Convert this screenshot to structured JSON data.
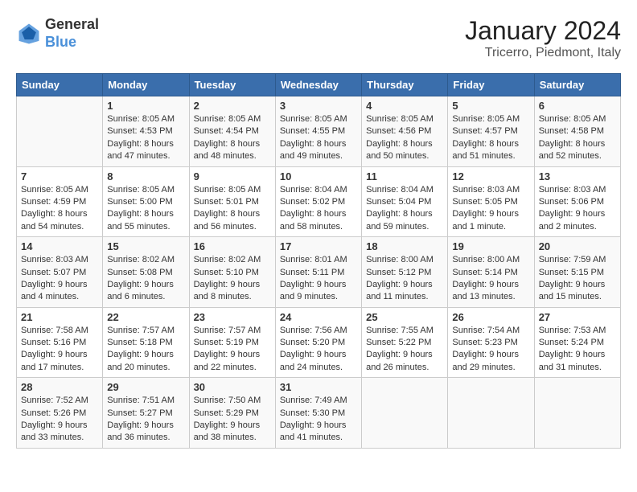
{
  "logo": {
    "text_general": "General",
    "text_blue": "Blue"
  },
  "title": "January 2024",
  "subtitle": "Tricerro, Piedmont, Italy",
  "days_of_week": [
    "Sunday",
    "Monday",
    "Tuesday",
    "Wednesday",
    "Thursday",
    "Friday",
    "Saturday"
  ],
  "weeks": [
    [
      {
        "day": "",
        "info": ""
      },
      {
        "day": "1",
        "info": "Sunrise: 8:05 AM\nSunset: 4:53 PM\nDaylight: 8 hours\nand 47 minutes."
      },
      {
        "day": "2",
        "info": "Sunrise: 8:05 AM\nSunset: 4:54 PM\nDaylight: 8 hours\nand 48 minutes."
      },
      {
        "day": "3",
        "info": "Sunrise: 8:05 AM\nSunset: 4:55 PM\nDaylight: 8 hours\nand 49 minutes."
      },
      {
        "day": "4",
        "info": "Sunrise: 8:05 AM\nSunset: 4:56 PM\nDaylight: 8 hours\nand 50 minutes."
      },
      {
        "day": "5",
        "info": "Sunrise: 8:05 AM\nSunset: 4:57 PM\nDaylight: 8 hours\nand 51 minutes."
      },
      {
        "day": "6",
        "info": "Sunrise: 8:05 AM\nSunset: 4:58 PM\nDaylight: 8 hours\nand 52 minutes."
      }
    ],
    [
      {
        "day": "7",
        "info": "Sunrise: 8:05 AM\nSunset: 4:59 PM\nDaylight: 8 hours\nand 54 minutes."
      },
      {
        "day": "8",
        "info": "Sunrise: 8:05 AM\nSunset: 5:00 PM\nDaylight: 8 hours\nand 55 minutes."
      },
      {
        "day": "9",
        "info": "Sunrise: 8:05 AM\nSunset: 5:01 PM\nDaylight: 8 hours\nand 56 minutes."
      },
      {
        "day": "10",
        "info": "Sunrise: 8:04 AM\nSunset: 5:02 PM\nDaylight: 8 hours\nand 58 minutes."
      },
      {
        "day": "11",
        "info": "Sunrise: 8:04 AM\nSunset: 5:04 PM\nDaylight: 8 hours\nand 59 minutes."
      },
      {
        "day": "12",
        "info": "Sunrise: 8:03 AM\nSunset: 5:05 PM\nDaylight: 9 hours\nand 1 minute."
      },
      {
        "day": "13",
        "info": "Sunrise: 8:03 AM\nSunset: 5:06 PM\nDaylight: 9 hours\nand 2 minutes."
      }
    ],
    [
      {
        "day": "14",
        "info": "Sunrise: 8:03 AM\nSunset: 5:07 PM\nDaylight: 9 hours\nand 4 minutes."
      },
      {
        "day": "15",
        "info": "Sunrise: 8:02 AM\nSunset: 5:08 PM\nDaylight: 9 hours\nand 6 minutes."
      },
      {
        "day": "16",
        "info": "Sunrise: 8:02 AM\nSunset: 5:10 PM\nDaylight: 9 hours\nand 8 minutes."
      },
      {
        "day": "17",
        "info": "Sunrise: 8:01 AM\nSunset: 5:11 PM\nDaylight: 9 hours\nand 9 minutes."
      },
      {
        "day": "18",
        "info": "Sunrise: 8:00 AM\nSunset: 5:12 PM\nDaylight: 9 hours\nand 11 minutes."
      },
      {
        "day": "19",
        "info": "Sunrise: 8:00 AM\nSunset: 5:14 PM\nDaylight: 9 hours\nand 13 minutes."
      },
      {
        "day": "20",
        "info": "Sunrise: 7:59 AM\nSunset: 5:15 PM\nDaylight: 9 hours\nand 15 minutes."
      }
    ],
    [
      {
        "day": "21",
        "info": "Sunrise: 7:58 AM\nSunset: 5:16 PM\nDaylight: 9 hours\nand 17 minutes."
      },
      {
        "day": "22",
        "info": "Sunrise: 7:57 AM\nSunset: 5:18 PM\nDaylight: 9 hours\nand 20 minutes."
      },
      {
        "day": "23",
        "info": "Sunrise: 7:57 AM\nSunset: 5:19 PM\nDaylight: 9 hours\nand 22 minutes."
      },
      {
        "day": "24",
        "info": "Sunrise: 7:56 AM\nSunset: 5:20 PM\nDaylight: 9 hours\nand 24 minutes."
      },
      {
        "day": "25",
        "info": "Sunrise: 7:55 AM\nSunset: 5:22 PM\nDaylight: 9 hours\nand 26 minutes."
      },
      {
        "day": "26",
        "info": "Sunrise: 7:54 AM\nSunset: 5:23 PM\nDaylight: 9 hours\nand 29 minutes."
      },
      {
        "day": "27",
        "info": "Sunrise: 7:53 AM\nSunset: 5:24 PM\nDaylight: 9 hours\nand 31 minutes."
      }
    ],
    [
      {
        "day": "28",
        "info": "Sunrise: 7:52 AM\nSunset: 5:26 PM\nDaylight: 9 hours\nand 33 minutes."
      },
      {
        "day": "29",
        "info": "Sunrise: 7:51 AM\nSunset: 5:27 PM\nDaylight: 9 hours\nand 36 minutes."
      },
      {
        "day": "30",
        "info": "Sunrise: 7:50 AM\nSunset: 5:29 PM\nDaylight: 9 hours\nand 38 minutes."
      },
      {
        "day": "31",
        "info": "Sunrise: 7:49 AM\nSunset: 5:30 PM\nDaylight: 9 hours\nand 41 minutes."
      },
      {
        "day": "",
        "info": ""
      },
      {
        "day": "",
        "info": ""
      },
      {
        "day": "",
        "info": ""
      }
    ]
  ]
}
